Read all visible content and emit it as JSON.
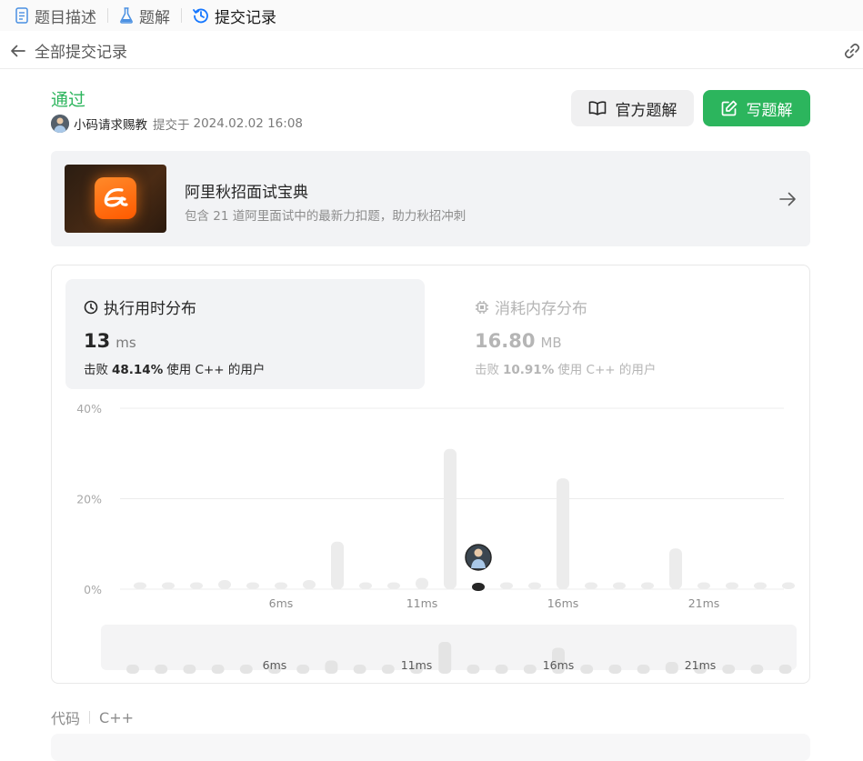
{
  "tabs": [
    {
      "label": "题目描述",
      "icon": "document-icon"
    },
    {
      "label": "题解",
      "icon": "flask-icon"
    },
    {
      "label": "提交记录",
      "icon": "history-icon"
    }
  ],
  "subheader": {
    "title": "全部提交记录"
  },
  "submission": {
    "status": "通过",
    "author": "小码请求赐教",
    "submit_label": "提交于",
    "submit_time": "2024.02.02 16:08"
  },
  "buttons": {
    "official": "官方题解",
    "write": "写题解"
  },
  "promo": {
    "title": "阿里秋招面试宝典",
    "description": "包含 21 道阿里面试中的最新力扣题，助力秋招冲刺"
  },
  "runtime": {
    "title": "执行用时分布",
    "value": "13",
    "unit": "ms",
    "beat_prefix": "击败",
    "beat_percent": "48.14%",
    "beat_suffix": "使用 C++ 的用户"
  },
  "memory": {
    "title": "消耗内存分布",
    "value": "16.80",
    "unit": "MB",
    "beat_prefix": "击败",
    "beat_percent": "10.91%",
    "beat_suffix": "使用 C++ 的用户"
  },
  "code": {
    "label": "代码",
    "language": "C++"
  },
  "colors": {
    "accent_green": "#2cb55d",
    "bar": "#ececec",
    "highlight_bar": "#262626"
  },
  "chart_data": {
    "type": "bar",
    "x": [
      1,
      2,
      3,
      4,
      5,
      6,
      7,
      8,
      9,
      10,
      11,
      12,
      13,
      14,
      15,
      16,
      17,
      18,
      19,
      20,
      21,
      22,
      23,
      24
    ],
    "values": [
      1.5,
      1.5,
      1.5,
      2,
      1.5,
      1.5,
      2,
      10.5,
      1.5,
      1.5,
      2.5,
      31,
      1.5,
      1.5,
      1.5,
      24.5,
      1.5,
      1.5,
      1.5,
      9,
      1.5,
      1.5,
      1.5,
      1.5
    ],
    "highlight_x": 13,
    "ylim": [
      0,
      40
    ],
    "yticks": [
      "0%",
      "20%",
      "40%"
    ],
    "xticks": [
      "6ms",
      "11ms",
      "16ms",
      "21ms"
    ],
    "grid": true
  }
}
